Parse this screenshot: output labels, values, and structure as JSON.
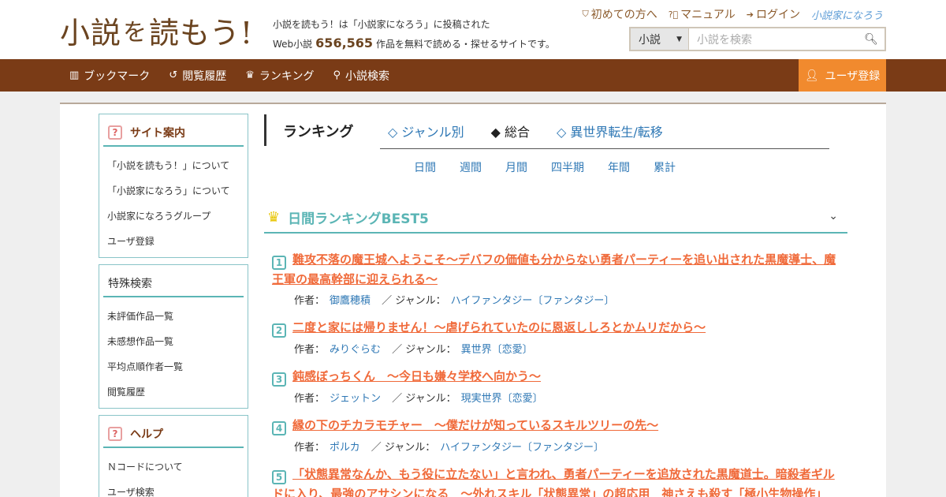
{
  "header": {
    "logo_text_1": "小説",
    "logo_text_2": "を",
    "logo_text_3": "読もう!",
    "tagline_line1": "小説を読もう！は「小説家になろう」に投稿された",
    "tagline_prefix": "Web小説",
    "work_count": "656,565",
    "tagline_suffix": "作品を無料で読める・探せるサイトです。",
    "links": {
      "first_time": "初めての方へ",
      "manual": "マニュアル",
      "login": "ログイン",
      "narou": "小説家になろう"
    },
    "search": {
      "category": "小説",
      "placeholder": "小説を検索"
    }
  },
  "nav": {
    "bookmark": "ブックマーク",
    "history": "閲覧履歴",
    "ranking": "ランキング",
    "search": "小説検索",
    "register": "ユーザ登録"
  },
  "sidebar": {
    "site_guide": {
      "title": "サイト案内",
      "items": [
        "「小説を読もう！」について",
        "「小説家になろう」について",
        "小説家になろうグループ",
        "ユーザ登録"
      ]
    },
    "special_search": {
      "title": "特殊検索",
      "items": [
        "未評価作品一覧",
        "未感想作品一覧",
        "平均点順作者一覧",
        "閲覧履歴"
      ]
    },
    "help": {
      "title": "ヘルプ",
      "items": [
        "Ｎコードについて",
        "ユーザ検索"
      ]
    }
  },
  "main": {
    "heading": "ランキング",
    "tabs": [
      "◇ ジャンル別",
      "◆ 総合",
      "◇ 異世界転生/転移"
    ],
    "periods": [
      "日間",
      "週間",
      "月間",
      "四半期",
      "年間",
      "累計"
    ],
    "section_title": "日間ランキングBEST5",
    "author_label": "作者：",
    "genre_label": "／ ジャンル：",
    "rankings": [
      {
        "rank": "1",
        "title": "難攻不落の魔王城へようこそ～デバフの価値も分からない勇者パーティーを追い出された黒魔導士、魔王軍の最高幹部に迎えられる～",
        "author": "御鷹穂積",
        "genre": "ハイファンタジー〔ファンタジー〕"
      },
      {
        "rank": "2",
        "title": "二度と家には帰りません！～虐げられていたのに恩返ししろとかムリだから～",
        "author": "みりぐらむ",
        "genre": "異世界〔恋愛〕"
      },
      {
        "rank": "3",
        "title": "鈍感ぼっちくん　～今日も嫌々学校へ向かう～",
        "author": "ジェットン",
        "genre": "現実世界〔恋愛〕"
      },
      {
        "rank": "4",
        "title": "縁の下のチカラモチャー　～僕だけが知っているスキルツリーの先～",
        "author": "ポルカ",
        "genre": "ハイファンタジー〔ファンタジー〕"
      },
      {
        "rank": "5",
        "title": "「状態異常なんか、もう役に立たない」と言われ、勇者パーティーを追放された黒魔道士。暗殺者ギルドに入り、最強のアサシンになる　～外れスキル「状態異常」の超応用　神さえも殺す「極小生物操作」",
        "author": "",
        "genre": ""
      }
    ]
  }
}
